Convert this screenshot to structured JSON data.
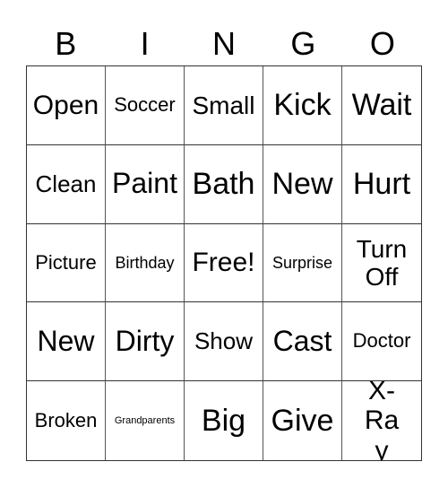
{
  "card": {
    "header": [
      "B",
      "I",
      "N",
      "G",
      "O"
    ],
    "rows": [
      [
        {
          "text": "Open",
          "size": 30
        },
        {
          "text": "Soccer",
          "size": 22
        },
        {
          "text": "Small",
          "size": 28
        },
        {
          "text": "Kick",
          "size": 34
        },
        {
          "text": "Wait",
          "size": 34
        }
      ],
      [
        {
          "text": "Clean",
          "size": 26
        },
        {
          "text": "Paint",
          "size": 32
        },
        {
          "text": "Bath",
          "size": 34
        },
        {
          "text": "New",
          "size": 34
        },
        {
          "text": "Hurt",
          "size": 34
        }
      ],
      [
        {
          "text": "Picture",
          "size": 22
        },
        {
          "text": "Birthday",
          "size": 18
        },
        {
          "text": "Free!",
          "size": 30
        },
        {
          "text": "Surprise",
          "size": 18
        },
        {
          "text": "Turn Off",
          "size": 28
        }
      ],
      [
        {
          "text": "New",
          "size": 32
        },
        {
          "text": "Dirty",
          "size": 32
        },
        {
          "text": "Show",
          "size": 26
        },
        {
          "text": "Cast",
          "size": 32
        },
        {
          "text": "Doctor",
          "size": 22
        }
      ],
      [
        {
          "text": "Broken",
          "size": 22
        },
        {
          "text": "Grandparents",
          "size": 11
        },
        {
          "text": "Big",
          "size": 34
        },
        {
          "text": "Give",
          "size": 34
        },
        {
          "text": "X-Ray",
          "size": 30
        }
      ]
    ]
  }
}
